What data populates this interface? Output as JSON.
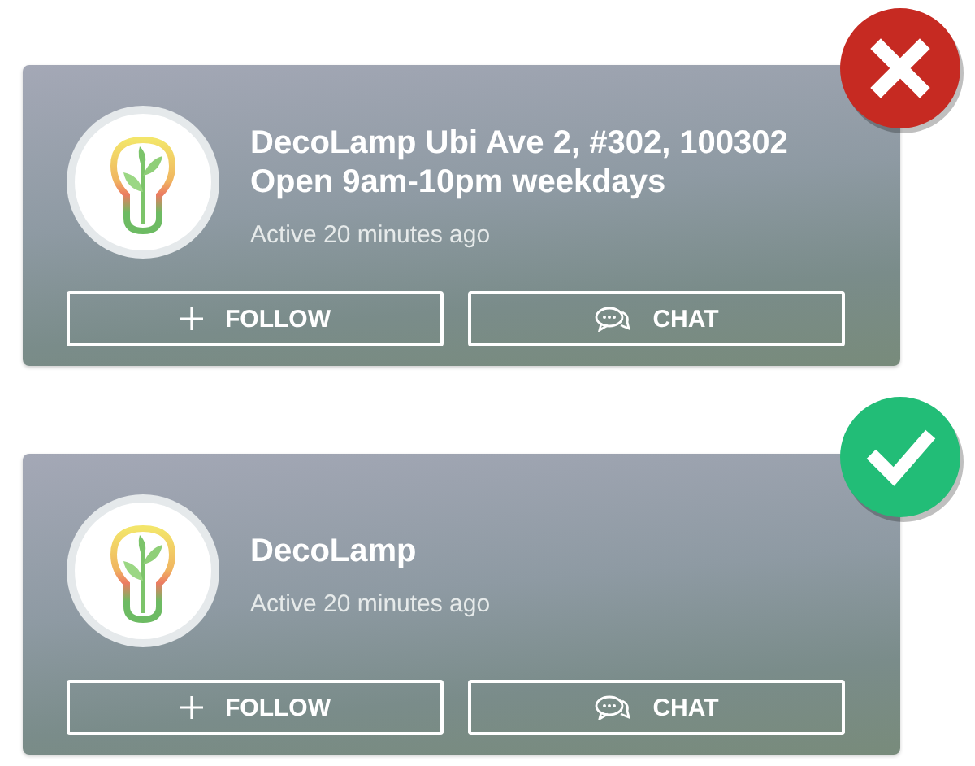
{
  "cards": [
    {
      "kind": "wrong",
      "title_lines": [
        "DecoLamp Ubi Ave 2, #302, 100302",
        "Open 9am-10pm weekdays"
      ],
      "status": "Active 20 minutes ago",
      "buttons": [
        {
          "kind": "follow",
          "label": "FOLLOW"
        },
        {
          "kind": "chat",
          "label": "CHAT"
        }
      ]
    },
    {
      "kind": "right",
      "title_lines": [
        "DecoLamp"
      ],
      "status": "Active 20 minutes ago",
      "buttons": [
        {
          "kind": "follow",
          "label": "FOLLOW"
        },
        {
          "kind": "chat",
          "label": "CHAT"
        }
      ]
    }
  ]
}
